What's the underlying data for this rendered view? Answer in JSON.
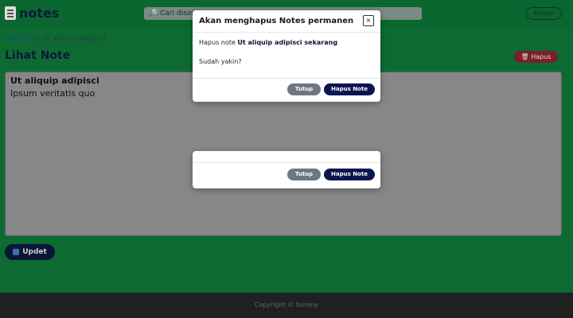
{
  "navbar": {
    "brand": "notes",
    "search_placeholder": "🔎 Cari disini...",
    "logout_label": "Keluar"
  },
  "breadcrumb": {
    "home": "Beranda",
    "separator": "/",
    "current": "Ut aliquip adipisci"
  },
  "page": {
    "title": "Lihat Note",
    "delete_label": "🗑 Hapus",
    "note_title": "Ut aliquip adipisci",
    "note_body": "Ipsum veritatis quo",
    "update_label": "Updet"
  },
  "modal": {
    "title": "Akan menghapus Notes permanen",
    "close_symbol": "×",
    "message_prefix": "Hapus note ",
    "message_note": "Ut aliquip adipisci sekarang",
    "confirm_question": "Sudah yakin?",
    "cancel_label": "Tutup",
    "confirm_label": "Hapus Note"
  },
  "footer": {
    "text": "Copyright © tommy"
  },
  "colors": {
    "background": "#0d6b32",
    "primary": "#0b1550",
    "danger": "#7b1f2a",
    "secondary": "#6d7780"
  }
}
